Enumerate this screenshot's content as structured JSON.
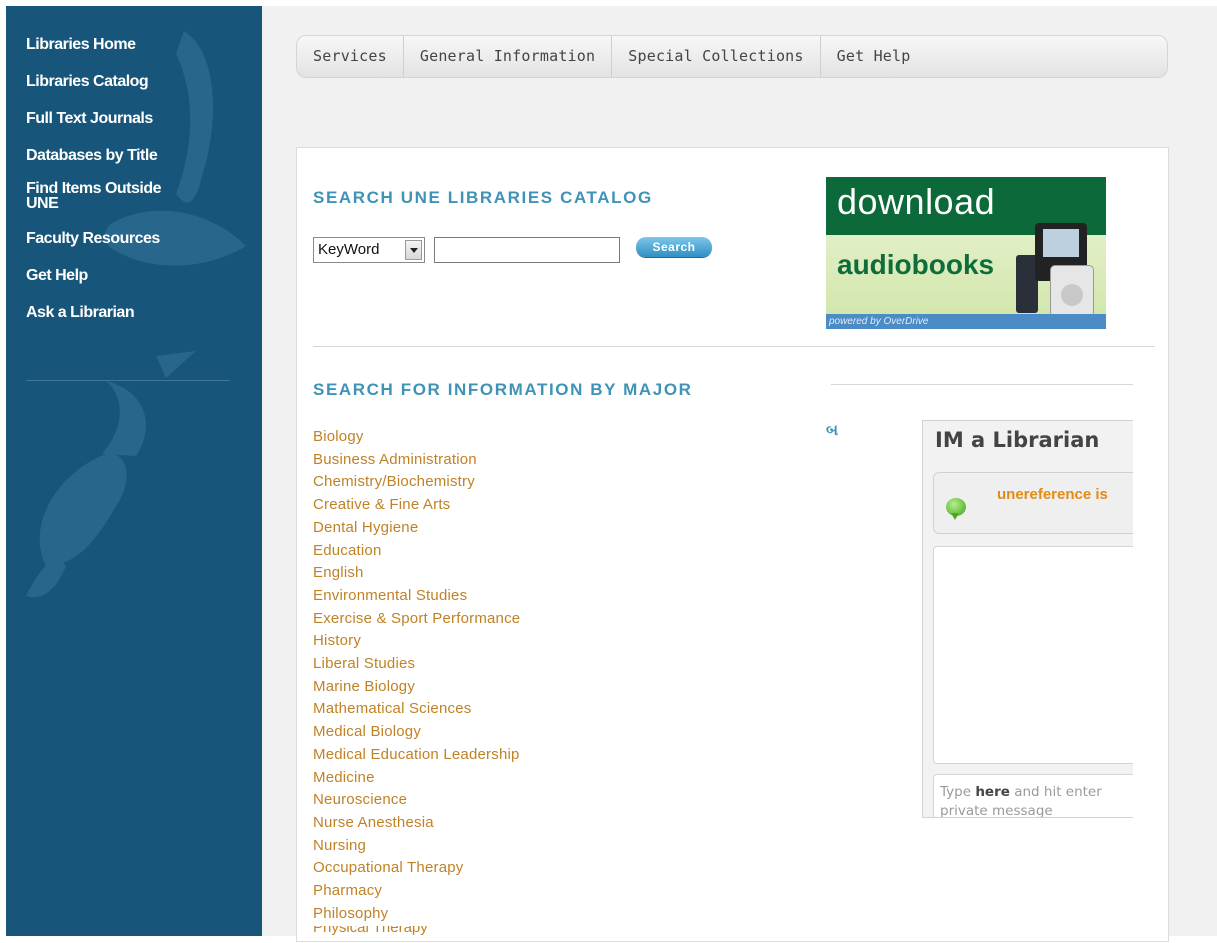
{
  "sidebar": {
    "items": [
      {
        "label": "Libraries Home"
      },
      {
        "label": "Libraries Catalog"
      },
      {
        "label": "Full Text Journals"
      },
      {
        "label": "Databases by Title"
      },
      {
        "label": "Find Items Outside UNE"
      },
      {
        "label": "Faculty Resources"
      },
      {
        "label": "Get Help"
      },
      {
        "label": "Ask a Librarian"
      }
    ]
  },
  "topnav": {
    "tabs": [
      {
        "label": "Services"
      },
      {
        "label": "General Information"
      },
      {
        "label": "Special Collections"
      },
      {
        "label": "Get Help"
      }
    ]
  },
  "catalog": {
    "heading": "SEARCH UNE LIBRARIES CATALOG",
    "select_value": "KeyWord",
    "search_value": "",
    "button_label": "Search"
  },
  "banner": {
    "line1": "download",
    "line2": "audiobooks",
    "powered": "powered by OverDrive"
  },
  "majors": {
    "heading": "SEARCH FOR INFORMATION BY MAJOR",
    "items": [
      "Biology",
      "Business Administration",
      "Chemistry/Biochemistry",
      "Creative & Fine Arts",
      "Dental Hygiene",
      "Education",
      "English",
      "Environmental Studies",
      "Exercise & Sport Performance",
      "History",
      "Liberal Studies",
      "Marine Biology",
      "Mathematical Sciences",
      "Medical Biology",
      "Medical Education Leadership",
      "Medicine",
      "Neuroscience",
      "Nurse Anesthesia",
      "Nursing",
      "Occupational Therapy",
      "Pharmacy",
      "Philosophy"
    ],
    "partial_item": "Physical Therapy"
  },
  "stray_glyph": "બ",
  "im_widget": {
    "title": "IM a Librarian",
    "status_text": "unereference is",
    "input_pre": "Type ",
    "input_bold": "here",
    "input_post": " and hit enter",
    "input_line2": "private message"
  },
  "colors": {
    "sidebar_bg": "#17567a",
    "heading_blue": "#3f93b6",
    "link_orange": "#c08226",
    "status_orange": "#e38b12",
    "banner_green": "#0c6a3a"
  }
}
